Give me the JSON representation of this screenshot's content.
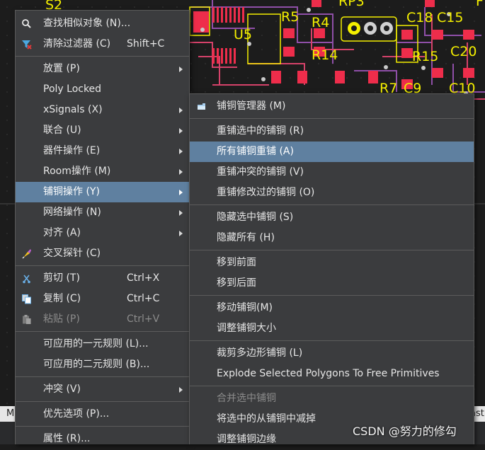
{
  "pcb": {
    "labels": [
      "S2",
      "R5",
      "R4",
      "RP3",
      "C18",
      "C15",
      "U5",
      "R14",
      "R15",
      "C20",
      "R7",
      "C9",
      "C10",
      "F"
    ]
  },
  "status": {
    "left": "M",
    "right": "ast"
  },
  "watermark": "CSDN @努力的修勾",
  "main_menu": {
    "items": [
      {
        "label": "查找相似对象 (N)...",
        "icon": "search-icon"
      },
      {
        "label": "清除过滤器 (C)",
        "shortcut": "Shift+C",
        "icon": "clear-filter-icon"
      },
      {
        "label": "放置 (P)",
        "submenu": true
      },
      {
        "label": "Poly Locked"
      },
      {
        "label": "xSignals (X)",
        "submenu": true
      },
      {
        "label": "联合 (U)",
        "submenu": true
      },
      {
        "label": "器件操作 (E)",
        "submenu": true
      },
      {
        "label": "Room操作 (M)",
        "submenu": true
      },
      {
        "label": "铺铜操作 (Y)",
        "submenu": true,
        "highlighted": true
      },
      {
        "label": "网络操作 (N)",
        "submenu": true
      },
      {
        "label": "对齐 (A)",
        "submenu": true
      },
      {
        "label": "交叉探针 (C)",
        "icon": "cross-probe-icon"
      },
      {
        "label": "剪切 (T)",
        "shortcut": "Ctrl+X",
        "icon": "scissors-icon"
      },
      {
        "label": "复制 (C)",
        "shortcut": "Ctrl+C",
        "icon": "copy-icon"
      },
      {
        "label": "粘贴 (P)",
        "shortcut": "Ctrl+V",
        "icon": "paste-icon",
        "disabled": true
      },
      {
        "label": "可应用的一元规则 (L)..."
      },
      {
        "label": "可应用的二元规则 (B)..."
      },
      {
        "label": "冲突 (V)",
        "submenu": true
      },
      {
        "label": "优先选项 (P)..."
      },
      {
        "label": "属性 (R)..."
      }
    ]
  },
  "sub_menu": {
    "items": [
      {
        "label": "铺铜管理器 (M)",
        "icon": "polygon-manager-icon"
      },
      {
        "label": "重铺选中的铺铜 (R)"
      },
      {
        "label": "所有铺铜重铺 (A)",
        "highlighted": true
      },
      {
        "label": "重铺冲突的铺铜 (V)"
      },
      {
        "label": "重铺修改过的铺铜 (O)"
      },
      {
        "label": "隐藏选中铺铜 (S)"
      },
      {
        "label": "隐藏所有 (H)"
      },
      {
        "label": "移到前面"
      },
      {
        "label": "移到后面"
      },
      {
        "label": "移动铺铜(M)"
      },
      {
        "label": "调整铺铜大小"
      },
      {
        "label": "裁剪多边形铺铜 (L)"
      },
      {
        "label": "Explode Selected Polygons To Free Primitives"
      },
      {
        "label": "合并选中铺铜",
        "disabled": true
      },
      {
        "label": "将选中的从铺铜中减掉"
      },
      {
        "label": "调整铺铜边缘"
      }
    ]
  },
  "colors": {
    "menu_bg": "#3b3c3e",
    "highlight": "#5f80a0",
    "pcb_bg": "#1c1c1c",
    "pcb_label": "#f4ef00",
    "pad": "#ee2d4b",
    "track": "#d5426a"
  }
}
